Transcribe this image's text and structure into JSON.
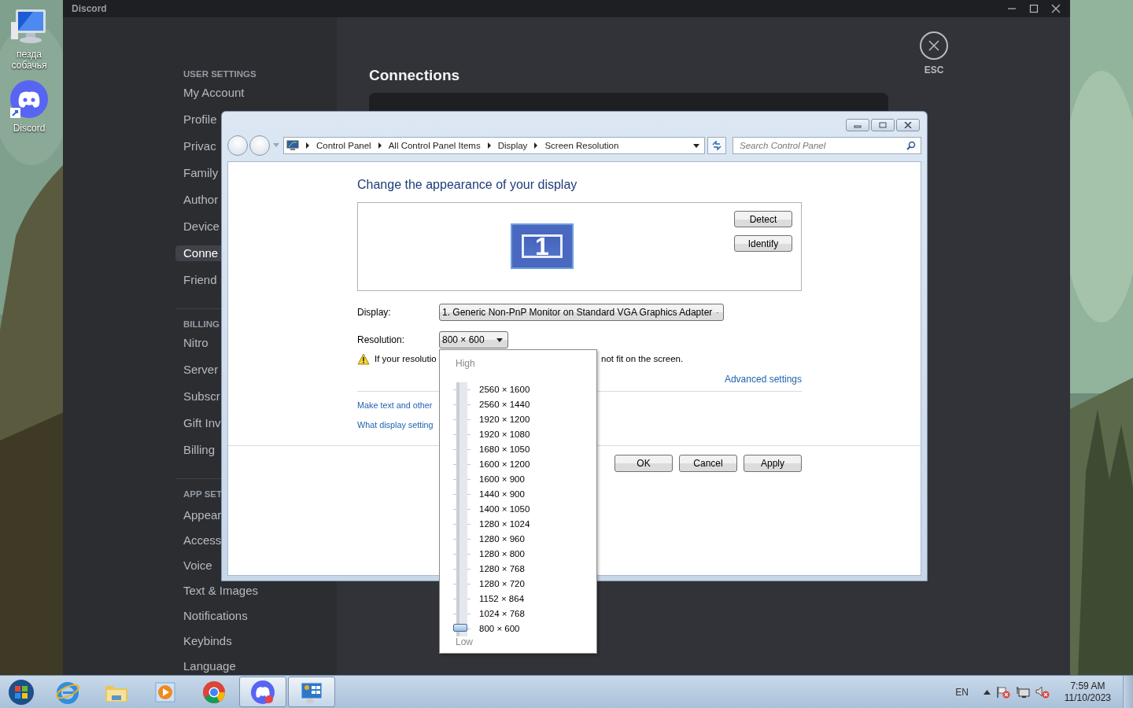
{
  "desktop": {
    "icons": [
      {
        "kind": "computer",
        "label": "пезда собачья"
      },
      {
        "kind": "discord",
        "label": "Discord"
      }
    ]
  },
  "discord": {
    "title": "Discord",
    "sidebar": [
      {
        "header": "USER SETTINGS",
        "items": [
          {
            "label": "My Account",
            "selected": false
          },
          {
            "label": "Profile",
            "selected": false
          },
          {
            "label": "Privac",
            "selected": false
          },
          {
            "label": "Family",
            "selected": false
          },
          {
            "label": "Author",
            "selected": false
          },
          {
            "label": "Device",
            "selected": false
          },
          {
            "label": "Conne",
            "selected": true
          },
          {
            "label": "Friend",
            "selected": false
          }
        ]
      },
      {
        "header": "BILLING",
        "items": [
          {
            "label": "Nitro",
            "selected": false
          },
          {
            "label": "Server",
            "selected": false
          },
          {
            "label": "Subscr",
            "selected": false
          },
          {
            "label": "Gift Inv",
            "selected": false
          },
          {
            "label": "Billing",
            "selected": false
          }
        ]
      },
      {
        "header": "APP SET",
        "items": [
          {
            "label": "Appear",
            "selected": false
          },
          {
            "label": "Access",
            "selected": false
          },
          {
            "label": "Voice",
            "selected": false
          },
          {
            "label": "Text & Images",
            "selected": false
          },
          {
            "label": "Notifications",
            "selected": false
          },
          {
            "label": "Keybinds",
            "selected": false
          },
          {
            "label": "Language",
            "selected": false
          }
        ]
      }
    ],
    "heading": "Connections",
    "close_label": "ESC"
  },
  "control_panel": {
    "breadcrumb": [
      "Control Panel",
      "All Control Panel Items",
      "Display",
      "Screen Resolution"
    ],
    "search": {
      "placeholder": "Search Control Panel"
    },
    "heading": "Change the appearance of your display",
    "monitor_number": "1",
    "side_buttons": [
      "Detect",
      "Identify"
    ],
    "display": {
      "label": "Display:",
      "value": "1. Generic Non-PnP Monitor on Standard VGA Graphics Adapter"
    },
    "resolution": {
      "label": "Resolution:",
      "value": "800 × 600"
    },
    "warning": [
      "If your resolutio",
      "not fit on the screen."
    ],
    "advanced_link": "Advanced settings",
    "links": [
      "Make text and other",
      "What display setting"
    ],
    "buttons": [
      "OK",
      "Cancel",
      "Apply"
    ]
  },
  "resolution_menu": {
    "high_label": "High",
    "low_label": "Low",
    "level": 0,
    "options": [
      "2560 × 1600",
      "2560 × 1440",
      "1920 × 1200",
      "1920 × 1080",
      "1680 × 1050",
      "1600 × 1200",
      "1600 × 900",
      "1440 × 900",
      "1400 × 1050",
      "1280 × 1024",
      "1280 × 960",
      "1280 × 800",
      "1280 × 768",
      "1280 × 720",
      "1152 × 864",
      "1024 × 768",
      "800 × 600"
    ]
  },
  "taskbar": {
    "apps": [
      {
        "kind": "ie",
        "open": false
      },
      {
        "kind": "explorer",
        "open": false
      },
      {
        "kind": "media",
        "open": false
      },
      {
        "kind": "chrome",
        "open": false
      },
      {
        "kind": "discord",
        "open": true
      },
      {
        "kind": "control_panel",
        "open": true
      }
    ],
    "language": "EN",
    "time": "7:59 AM",
    "date": "11/10/2023"
  }
}
